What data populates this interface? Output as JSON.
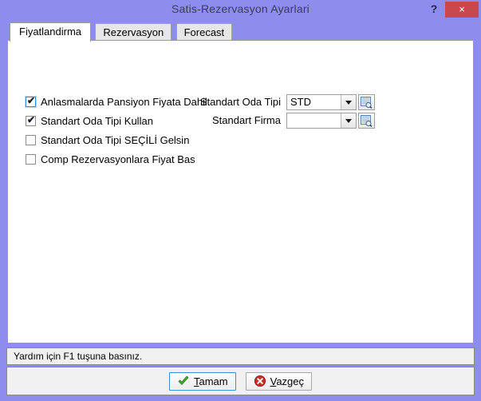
{
  "window": {
    "title": "Satis-Rezervasyon Ayarlari",
    "help_label": "?",
    "close_label": "×",
    "titlebar_color": "#8d8dee",
    "close_button_color": "#c9484e"
  },
  "tabs": [
    {
      "label": "Fiyatlandirma",
      "active": true
    },
    {
      "label": "Rezervasyon",
      "active": false
    },
    {
      "label": "Forecast",
      "active": false
    }
  ],
  "checkboxes": [
    {
      "label": "Anlasmalarda Pansiyon Fiyata Dahil",
      "checked": true,
      "focused": true,
      "mark": "✔"
    },
    {
      "label": "Standart Oda Tipi Kullan",
      "checked": true,
      "focused": false,
      "mark": "✔"
    },
    {
      "label": "Standart Oda Tipi SEÇİLİ Gelsin",
      "checked": false,
      "focused": false,
      "mark": ""
    },
    {
      "label": "Comp Rezervasyonlara Fiyat Bas",
      "checked": false,
      "focused": false,
      "mark": ""
    }
  ],
  "fields": [
    {
      "label": "Standart Oda Tipi",
      "value": "STD",
      "placeholder": "",
      "lookup_icon": "lookup-list-icon"
    },
    {
      "label": "Standart Firma",
      "value": "",
      "placeholder": "",
      "lookup_icon": "lookup-list-icon"
    }
  ],
  "statusbar": {
    "text": "Yardım için F1 tuşuna basınız."
  },
  "buttons": [
    {
      "accel": "T",
      "rest": "amam",
      "icon": "green-check-icon",
      "icon_color": "#49a832",
      "focused": true
    },
    {
      "accel": "V",
      "rest": "azgeç",
      "icon": "red-cancel-icon",
      "icon_color": "#cf2b2b",
      "focused": false
    }
  ]
}
